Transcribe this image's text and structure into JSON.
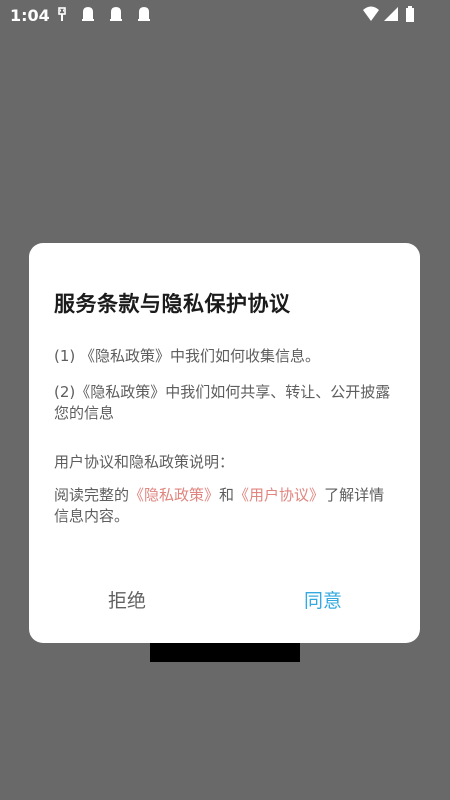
{
  "status_bar": {
    "time": "1:04",
    "icons": [
      "usb-icon",
      "notification-icon",
      "notification-icon",
      "notification-icon",
      "wifi-icon",
      "signal-icon",
      "battery-icon"
    ]
  },
  "dialog": {
    "title": "服务条款与隐私保护协议",
    "item1": "(1) 《隐私政策》中我们如何收集信息。",
    "item2": "(2)《隐私政策》中我们如何共享、转让、公开披露您的信息",
    "subhead": "用户协议和隐私政策说明：",
    "read_prefix": "阅读完整的",
    "privacy_link": "《隐私政策》",
    "and": "和",
    "user_agreement_link": "《用户协议》",
    "read_suffix": "了解详情信息内容。",
    "reject_label": "拒绝",
    "agree_label": "同意"
  },
  "colors": {
    "overlay": "#696969",
    "link": "#e0857f",
    "agree": "#34a9df"
  }
}
